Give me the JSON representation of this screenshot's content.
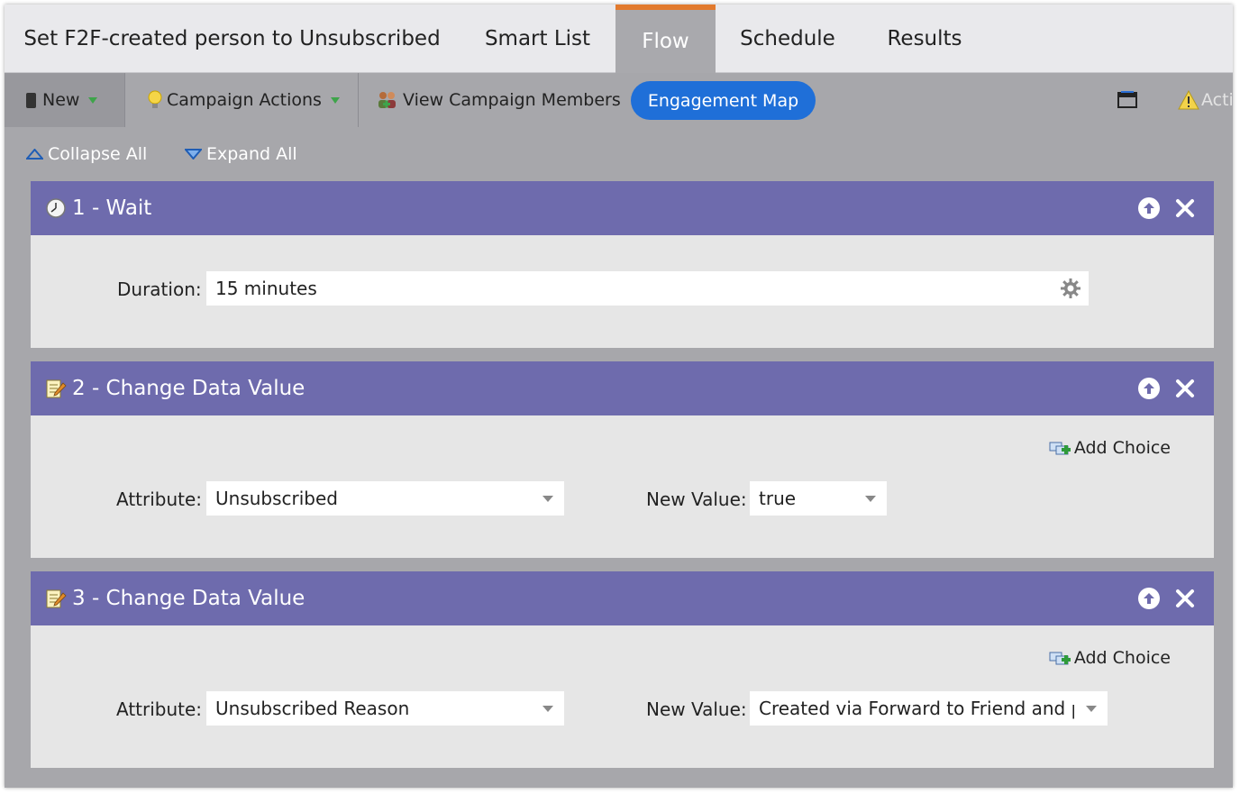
{
  "tabs": [
    {
      "label": "Set F2F-created person to Unsubscribed",
      "active": false
    },
    {
      "label": "Smart List",
      "active": false
    },
    {
      "label": "Flow",
      "active": true
    },
    {
      "label": "Schedule",
      "active": false
    },
    {
      "label": "Results",
      "active": false
    }
  ],
  "toolbar": {
    "new_label": "New",
    "campaign_actions_label": "Campaign Actions",
    "view_members_label": "View Campaign Members",
    "engagement_map_label": "Engagement Map",
    "activity_label": "Acti"
  },
  "subbar": {
    "collapse_label": "Collapse All",
    "expand_label": "Expand All"
  },
  "steps": [
    {
      "title": "1 - Wait",
      "icon": "clock-icon",
      "duration_label": "Duration:",
      "duration_value": "15 minutes"
    },
    {
      "title": "2 - Change Data Value",
      "icon": "edit-data-icon",
      "add_choice_label": "Add Choice",
      "attribute_label": "Attribute:",
      "attribute_value": "Unsubscribed",
      "new_value_label": "New Value:",
      "new_value": "true"
    },
    {
      "title": "3 - Change Data Value",
      "icon": "edit-data-icon",
      "add_choice_label": "Add Choice",
      "attribute_label": "Attribute:",
      "attribute_value": "Unsubscribed Reason",
      "new_value_label": "New Value:",
      "new_value": "Created via Forward to Friend and p"
    }
  ],
  "colors": {
    "step_header": "#6e6bad",
    "active_tab_accent": "#e27a2e",
    "pill": "#1f6fd8"
  }
}
